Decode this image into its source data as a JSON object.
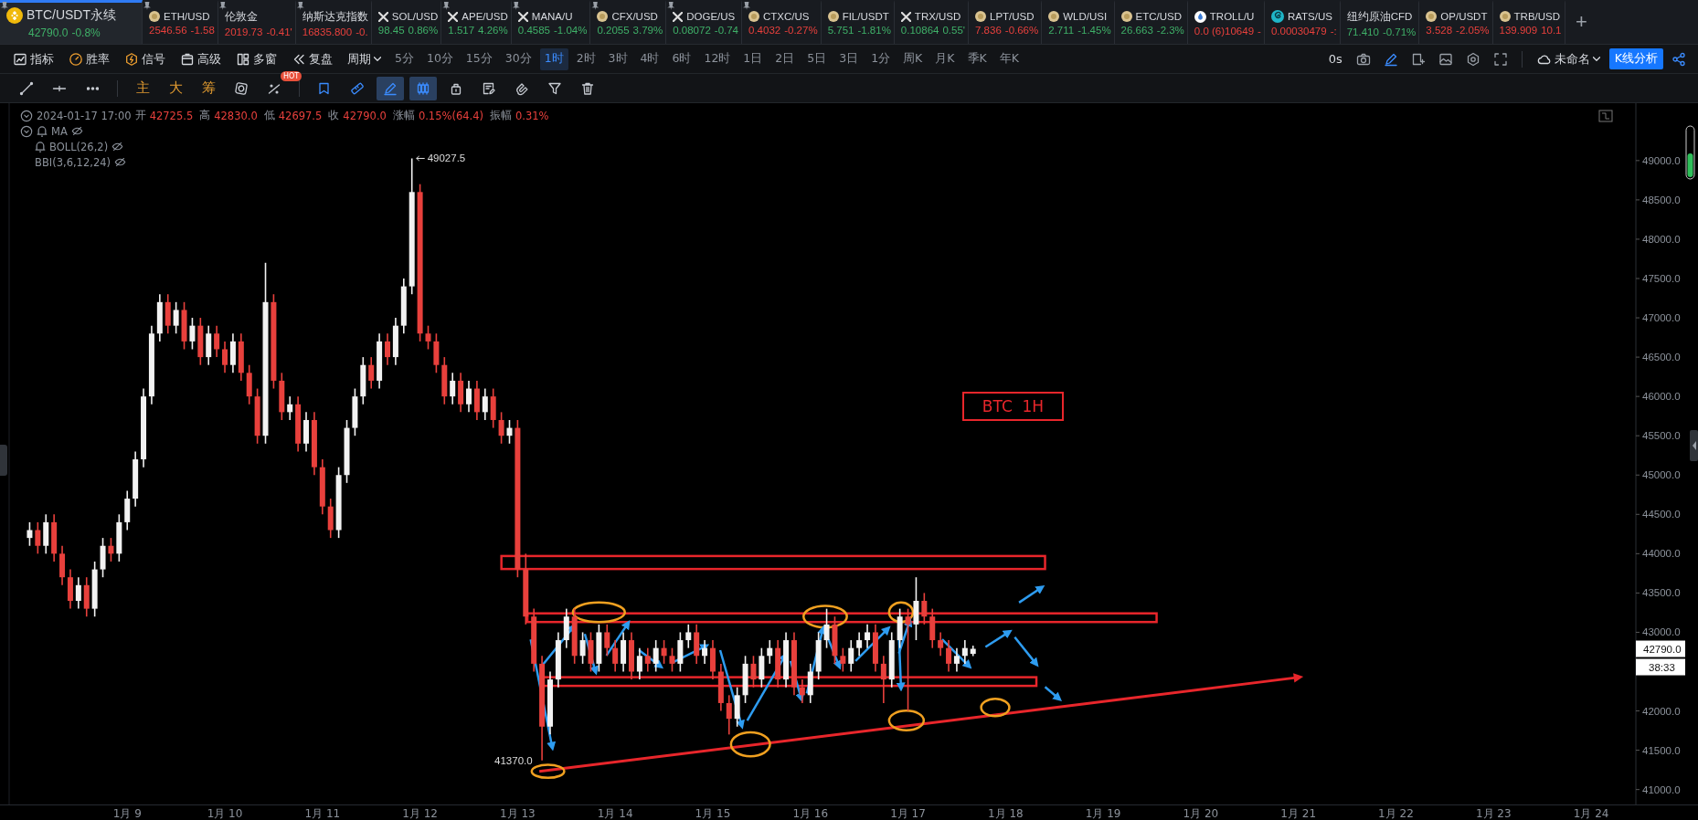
{
  "tickers": [
    {
      "name": "BTC/USDT永续",
      "price": "42790.0",
      "change": "-0.8%",
      "color": "#3fb068",
      "kind": "exchange",
      "pinned": true,
      "selected": true
    },
    {
      "name": "ETH/USD",
      "price": "2546.56",
      "change": "-1.58",
      "color": "#e8403c",
      "kind": "coin",
      "pinned": true,
      "selected": false
    },
    {
      "name": "伦敦金",
      "price": "2019.73",
      "change": "-0.41'",
      "color": "#e8403c",
      "kind": "none",
      "pinned": true,
      "selected": false
    },
    {
      "name": "纳斯达克指数",
      "price": "16835.800",
      "change": "-0.",
      "color": "#e8403c",
      "kind": "none",
      "pinned": true,
      "selected": false
    },
    {
      "name": "SOL/USD",
      "price": "98.45",
      "change": "0.86%",
      "color": "#3fb068",
      "kind": "swap",
      "pinned": false,
      "selected": false
    },
    {
      "name": "APE/USD",
      "price": "1.517",
      "change": "4.26%",
      "color": "#3fb068",
      "kind": "swap",
      "pinned": true,
      "selected": false
    },
    {
      "name": "MANA/U",
      "price": "0.4585",
      "change": "-1.04%",
      "color": "#3fb068",
      "kind": "swap",
      "pinned": true,
      "selected": false
    },
    {
      "name": "CFX/USD",
      "price": "0.2055",
      "change": "3.79%",
      "color": "#3fb068",
      "kind": "coin",
      "pinned": true,
      "selected": false
    },
    {
      "name": "DOGE/US",
      "price": "0.08072",
      "change": "-0.74",
      "color": "#3fb068",
      "kind": "swap",
      "pinned": true,
      "selected": false
    },
    {
      "name": "CTXC/US",
      "price": "0.4032",
      "change": "-0.27%",
      "color": "#e8403c",
      "kind": "coin",
      "pinned": true,
      "selected": false
    },
    {
      "name": "FIL/USDT",
      "price": "5.751",
      "change": "-1.81%",
      "color": "#3fb068",
      "kind": "coin",
      "pinned": false,
      "selected": false
    },
    {
      "name": "TRX/USD",
      "price": "0.10864",
      "change": "0.55'",
      "color": "#3fb068",
      "kind": "swap",
      "pinned": false,
      "selected": false
    },
    {
      "name": "LPT/USD",
      "price": "7.836",
      "change": "-0.66%",
      "color": "#e8403c",
      "kind": "coin",
      "pinned": false,
      "selected": false
    },
    {
      "name": "WLD/USI",
      "price": "2.711",
      "change": "-1.45%",
      "color": "#3fb068",
      "kind": "coin",
      "pinned": false,
      "selected": false
    },
    {
      "name": "ETC/USD",
      "price": "26.663",
      "change": "-2.3%",
      "color": "#3fb068",
      "kind": "coin",
      "pinned": false,
      "selected": false
    },
    {
      "name": "TROLL/U",
      "price": "0.0 (6)10649",
      "change": "-",
      "color": "#e8403c",
      "kind": "drop",
      "pinned": false,
      "selected": false
    },
    {
      "name": "RATS/US",
      "price": "0.00030479",
      "change": "-:",
      "color": "#e8403c",
      "kind": "spiral",
      "pinned": false,
      "selected": false
    },
    {
      "name": "纽约原油CFD",
      "price": "71.410",
      "change": "-0.71%",
      "color": "#3fb068",
      "kind": "none",
      "pinned": false,
      "selected": false
    },
    {
      "name": "OP/USDT",
      "price": "3.528",
      "change": "-2.05%",
      "color": "#e8403c",
      "kind": "coin",
      "pinned": false,
      "selected": false
    },
    {
      "name": "TRB/USD",
      "price": "139.909",
      "change": "10.1",
      "color": "#e8403c",
      "kind": "coin",
      "pinned": false,
      "selected": false
    }
  ],
  "add_button": "+",
  "toolbar": {
    "buttons": [
      "指标",
      "胜率",
      "信号",
      "高级",
      "多窗",
      "复盘"
    ],
    "period_label": "周期",
    "periods": [
      {
        "label": "5分",
        "selected": false
      },
      {
        "label": "10分",
        "selected": false
      },
      {
        "label": "15分",
        "selected": false
      },
      {
        "label": "30分",
        "selected": false
      },
      {
        "label": "1时",
        "selected": true
      },
      {
        "label": "2时",
        "selected": false
      },
      {
        "label": "3时",
        "selected": false
      },
      {
        "label": "4时",
        "selected": false
      },
      {
        "label": "6时",
        "selected": false
      },
      {
        "label": "12时",
        "selected": false
      },
      {
        "label": "1日",
        "selected": false
      },
      {
        "label": "2日",
        "selected": false
      },
      {
        "label": "5日",
        "selected": false
      },
      {
        "label": "3日",
        "selected": false
      },
      {
        "label": "1分",
        "selected": false
      },
      {
        "label": "周K",
        "selected": false
      },
      {
        "label": "月K",
        "selected": false
      },
      {
        "label": "季K",
        "selected": false
      },
      {
        "label": "年K",
        "selected": false
      }
    ],
    "timer": "0s",
    "layout_name": "未命名",
    "analysis_button": "K线分析"
  },
  "tools": [
    {
      "selected": false
    },
    {
      "selected": false
    },
    {
      "selected": false
    },
    {
      "label": "主",
      "selected": false
    },
    {
      "label": "大",
      "selected": false
    },
    {
      "label": "筹",
      "selected": false
    },
    {
      "selected": false
    },
    {
      "badge": "HOT",
      "selected": false
    },
    {
      "selected": false
    },
    {
      "selected": false
    },
    {
      "selected": true
    },
    {
      "selected": true
    },
    {
      "selected": false
    },
    {
      "selected": false
    },
    {
      "selected": false
    },
    {
      "selected": false
    },
    {
      "selected": false
    }
  ],
  "ohlc": {
    "datetime": "2024-01-17 17:00",
    "fields": [
      {
        "label": "开",
        "value": "42725.5"
      },
      {
        "label": "高",
        "value": "42830.0"
      },
      {
        "label": "低",
        "value": "42697.5"
      },
      {
        "label": "收",
        "value": "42790.0"
      },
      {
        "label": "涨幅",
        "value": "0.15%(64.4)"
      },
      {
        "label": "振幅",
        "value": "0.31%"
      }
    ]
  },
  "indicators": [
    {
      "name": "MA",
      "bell": true
    },
    {
      "name": "BOLL(26,2)",
      "bell": true
    },
    {
      "name": "BBI(3,6,12,24)",
      "bell": false
    }
  ],
  "chart_note": "BTC  1H",
  "price_tag": "42790.0",
  "countdown": "38:33",
  "chart_data": {
    "type": "candlestick",
    "categories": [
      null,
      null,
      null,
      null,
      null,
      null,
      null,
      null,
      null,
      null,
      null,
      null,
      "1月 9",
      null,
      null,
      null,
      null,
      null,
      null,
      null,
      null,
      null,
      null,
      null,
      "1月 10",
      null,
      null,
      null,
      null,
      null,
      null,
      null,
      null,
      null,
      null,
      null,
      "1月 11",
      null,
      null,
      null,
      null,
      null,
      null,
      null,
      null,
      null,
      null,
      null,
      "1月 12",
      null,
      null,
      null,
      null,
      null,
      null,
      null,
      null,
      null,
      null,
      null,
      "1月 13",
      null,
      null,
      null,
      null,
      null,
      null,
      null,
      null,
      null,
      null,
      null,
      "1月 14",
      null,
      null,
      null,
      null,
      null,
      null,
      null,
      null,
      null,
      null,
      null,
      "1月 15",
      null,
      null,
      null,
      null,
      null,
      null,
      null,
      null,
      null,
      null,
      null,
      "1月 16",
      null,
      null,
      null,
      null,
      null,
      null,
      null,
      null,
      null,
      null,
      null,
      "1月 17",
      null,
      null,
      null,
      null,
      null,
      null,
      null,
      null,
      null,
      null,
      null,
      "1月 18",
      null,
      null,
      null,
      null,
      null,
      null,
      null,
      null,
      null,
      null,
      null,
      "1月 19",
      null,
      null,
      null,
      null,
      null,
      null,
      null,
      null,
      null,
      null,
      null,
      "1月 20",
      null,
      null,
      null,
      null,
      null,
      null,
      null,
      null,
      null,
      null,
      null,
      "1月 21",
      null,
      null,
      null,
      null,
      null,
      null,
      null,
      null,
      null,
      null,
      null,
      "1月 22",
      null,
      null,
      null,
      null,
      null,
      null,
      null,
      null,
      null,
      null,
      null,
      "1月 23",
      null,
      null,
      null,
      null,
      null,
      null,
      null,
      null,
      null,
      null,
      null,
      "1月 24",
      null,
      null,
      null,
      null,
      null
    ],
    "series": [
      {
        "ohlc": [
          [
            44200,
            44400,
            44100,
            44300
          ],
          [
            44300,
            44400,
            44000,
            44100
          ],
          [
            44100,
            44500,
            44000,
            44400
          ],
          [
            44400,
            44500,
            43900,
            44000
          ],
          [
            44000,
            44100,
            43600,
            43700
          ],
          [
            43700,
            43800,
            43300,
            43400
          ],
          [
            43400,
            43700,
            43300,
            43600
          ],
          [
            43600,
            43700,
            43200,
            43300
          ],
          [
            43300,
            43900,
            43200,
            43800
          ],
          [
            43800,
            44200,
            43700,
            44100
          ],
          [
            44100,
            44200,
            43900,
            44000
          ],
          [
            44000,
            44500,
            43900,
            44400
          ],
          [
            44400,
            44800,
            44300,
            44700
          ],
          [
            44700,
            45300,
            44600,
            45200
          ],
          [
            45200,
            46100,
            45100,
            46000
          ],
          [
            46000,
            46900,
            45900,
            46800
          ],
          [
            46800,
            47300,
            46700,
            47200
          ],
          [
            47200,
            47300,
            46800,
            46900
          ],
          [
            46900,
            47200,
            46800,
            47100
          ],
          [
            47100,
            47200,
            46600,
            46700
          ],
          [
            46700,
            47000,
            46600,
            46900
          ],
          [
            46900,
            47000,
            46400,
            46500
          ],
          [
            46500,
            46900,
            46400,
            46800
          ],
          [
            46800,
            46900,
            46500,
            46600
          ],
          [
            46600,
            46700,
            46300,
            46400
          ],
          [
            46400,
            46800,
            46300,
            46700
          ],
          [
            46700,
            46800,
            46200,
            46300
          ],
          [
            46300,
            46400,
            45900,
            46000
          ],
          [
            46000,
            46100,
            45400,
            45500
          ],
          [
            45500,
            47700,
            45400,
            47200
          ],
          [
            47200,
            47300,
            46100,
            46200
          ],
          [
            46200,
            46300,
            45700,
            45800
          ],
          [
            45800,
            46000,
            45700,
            45900
          ],
          [
            45900,
            46000,
            45300,
            45400
          ],
          [
            45400,
            45800,
            45300,
            45700
          ],
          [
            45700,
            45800,
            45000,
            45100
          ],
          [
            45100,
            45200,
            44500,
            44600
          ],
          [
            44600,
            44700,
            44200,
            44300
          ],
          [
            44300,
            45100,
            44200,
            45000
          ],
          [
            45000,
            45700,
            44900,
            45600
          ],
          [
            45600,
            46100,
            45500,
            46000
          ],
          [
            46000,
            46500,
            45900,
            46400
          ],
          [
            46400,
            46500,
            46100,
            46200
          ],
          [
            46200,
            46800,
            46100,
            46700
          ],
          [
            46700,
            46800,
            46400,
            46500
          ],
          [
            46500,
            47000,
            46400,
            46900
          ],
          [
            46900,
            47500,
            46800,
            47400
          ],
          [
            47400,
            49027.5,
            47300,
            48600
          ],
          [
            48600,
            48700,
            46700,
            46800
          ],
          [
            46800,
            46900,
            46600,
            46700
          ],
          [
            46700,
            46800,
            46300,
            46400
          ],
          [
            46400,
            46500,
            45900,
            46000
          ],
          [
            46000,
            46300,
            45900,
            46200
          ],
          [
            46200,
            46300,
            45800,
            45900
          ],
          [
            45900,
            46200,
            45800,
            46100
          ],
          [
            46100,
            46200,
            45700,
            45800
          ],
          [
            45800,
            46100,
            45700,
            46000
          ],
          [
            46000,
            46100,
            45600,
            45700
          ],
          [
            45700,
            45800,
            45400,
            45500
          ],
          [
            45500,
            45700,
            45400,
            45600
          ],
          [
            45600,
            45700,
            43700,
            43800
          ],
          [
            43800,
            44000,
            43100,
            43200
          ],
          [
            43200,
            43300,
            42500,
            42600
          ],
          [
            42600,
            42700,
            41370,
            41800
          ],
          [
            41800,
            42500,
            41700,
            42400
          ],
          [
            42400,
            43000,
            42300,
            42900
          ],
          [
            42900,
            43300,
            42800,
            43200
          ],
          [
            43200,
            43300,
            42600,
            42700
          ],
          [
            42700,
            43000,
            42600,
            42900
          ],
          [
            42900,
            43000,
            42500,
            42600
          ],
          [
            42600,
            43100,
            42500,
            43000
          ],
          [
            43000,
            43100,
            42700,
            42800
          ],
          [
            42800,
            42900,
            42500,
            42600
          ],
          [
            42600,
            43000,
            42500,
            42900
          ],
          [
            42900,
            43000,
            42400,
            42500
          ],
          [
            42500,
            42800,
            42400,
            42700
          ],
          [
            42700,
            42800,
            42500,
            42600
          ],
          [
            42600,
            42900,
            42500,
            42800
          ],
          [
            42800,
            42900,
            42600,
            42700
          ],
          [
            42700,
            42800,
            42500,
            42600
          ],
          [
            42600,
            43000,
            42500,
            42900
          ],
          [
            42900,
            43100,
            42800,
            43000
          ],
          [
            43000,
            43100,
            42600,
            42700
          ],
          [
            42700,
            42900,
            42600,
            42800
          ],
          [
            42800,
            42900,
            42400,
            42500
          ],
          [
            42500,
            42600,
            42000,
            42100
          ],
          [
            42100,
            42200,
            41700,
            41900
          ],
          [
            41900,
            42300,
            41800,
            42200
          ],
          [
            42200,
            42700,
            42100,
            42600
          ],
          [
            42600,
            42700,
            42300,
            42400
          ],
          [
            42400,
            42800,
            42300,
            42700
          ],
          [
            42700,
            42900,
            42600,
            42800
          ],
          [
            42800,
            42900,
            42300,
            42400
          ],
          [
            42400,
            43000,
            42300,
            42900
          ],
          [
            42900,
            43000,
            42200,
            42300
          ],
          [
            42300,
            42400,
            42100,
            42200
          ],
          [
            42200,
            42600,
            42100,
            42500
          ],
          [
            42500,
            43000,
            42400,
            42900
          ],
          [
            42900,
            43300,
            42800,
            43100
          ],
          [
            43100,
            43200,
            42600,
            42700
          ],
          [
            42700,
            42800,
            42500,
            42600
          ],
          [
            42600,
            42900,
            42500,
            42800
          ],
          [
            42800,
            43000,
            42700,
            42900
          ],
          [
            42900,
            43100,
            42800,
            43000
          ],
          [
            43000,
            43100,
            42500,
            42600
          ],
          [
            42600,
            42700,
            42100,
            42400
          ],
          [
            42400,
            43000,
            42300,
            42900
          ],
          [
            42900,
            43300,
            42800,
            43200
          ],
          [
            43200,
            43300,
            42000,
            43100
          ],
          [
            43100,
            43700,
            42900,
            43400
          ],
          [
            43400,
            43500,
            43100,
            43200
          ],
          [
            43200,
            43300,
            42800,
            42900
          ],
          [
            42900,
            43000,
            42700,
            42800
          ],
          [
            42800,
            42900,
            42500,
            42600
          ],
          [
            42600,
            42800,
            42500,
            42700
          ],
          [
            42700,
            42900,
            42600,
            42800
          ],
          [
            42725.5,
            42830,
            42697.5,
            42790
          ],
          null,
          null,
          null,
          null,
          null,
          null,
          null,
          null,
          null,
          null,
          null,
          null,
          null,
          null,
          null,
          null,
          null,
          null,
          null,
          null,
          null,
          null,
          null,
          null,
          null,
          null,
          null,
          null,
          null,
          null,
          null,
          null,
          null,
          null,
          null,
          null,
          null,
          null,
          null,
          null,
          null,
          null,
          null,
          null,
          null,
          null,
          null,
          null,
          null,
          null,
          null,
          null,
          null,
          null,
          null,
          null,
          null,
          null,
          null,
          null,
          null,
          null,
          null,
          null,
          null,
          null,
          null,
          null,
          null,
          null,
          null,
          null,
          null,
          null,
          null,
          null,
          null,
          null,
          null,
          null,
          null
        ]
      }
    ],
    "ylim": [
      40810,
      49730
    ],
    "yticks": [
      {
        "value": 49000,
        "label": "49000.0"
      },
      {
        "value": 48500,
        "label": "48500.0"
      },
      {
        "value": 48000,
        "label": "48000.0"
      },
      {
        "value": 47500,
        "label": "47500.0"
      },
      {
        "value": 47000,
        "label": "47000.0"
      },
      {
        "value": 46500,
        "label": "46500.0"
      },
      {
        "value": 46000,
        "label": "46000.0"
      },
      {
        "value": 45500,
        "label": "45500.0"
      },
      {
        "value": 45000,
        "label": "45000.0"
      },
      {
        "value": 44500,
        "label": "44500.0"
      },
      {
        "value": 44000,
        "label": "44000.0"
      },
      {
        "value": 43500,
        "label": "43500.0"
      },
      {
        "value": 43000,
        "label": "43000.0"
      },
      {
        "value": 42000,
        "label": "42000.0"
      },
      {
        "value": 41500,
        "label": "41500.0"
      },
      {
        "value": 41000,
        "label": "41000.0"
      }
    ],
    "annotations": [
      "49027.5",
      "41370.0"
    ]
  }
}
